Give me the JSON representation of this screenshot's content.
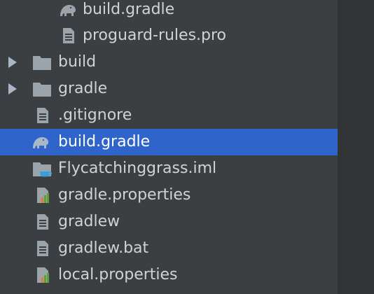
{
  "tree": {
    "items": [
      {
        "label": "build.gradle",
        "icon": "gradle-elephant-icon"
      },
      {
        "label": "proguard-rules.pro",
        "icon": "text-file-icon"
      },
      {
        "label": "build",
        "icon": "folder-icon"
      },
      {
        "label": "gradle",
        "icon": "folder-icon"
      },
      {
        "label": ".gitignore",
        "icon": "text-file-icon"
      },
      {
        "label": "build.gradle",
        "icon": "gradle-elephant-icon"
      },
      {
        "label": "Flycatchinggrass.iml",
        "icon": "module-folder-icon"
      },
      {
        "label": "gradle.properties",
        "icon": "properties-file-icon"
      },
      {
        "label": "gradlew",
        "icon": "text-file-icon"
      },
      {
        "label": "gradlew.bat",
        "icon": "text-file-icon"
      },
      {
        "label": "local.properties",
        "icon": "properties-file-icon"
      }
    ]
  },
  "colors": {
    "background": "#3c3f41",
    "selection": "#2f65ca",
    "text": "#d2d2d2",
    "icon": "#9ba3ab"
  }
}
